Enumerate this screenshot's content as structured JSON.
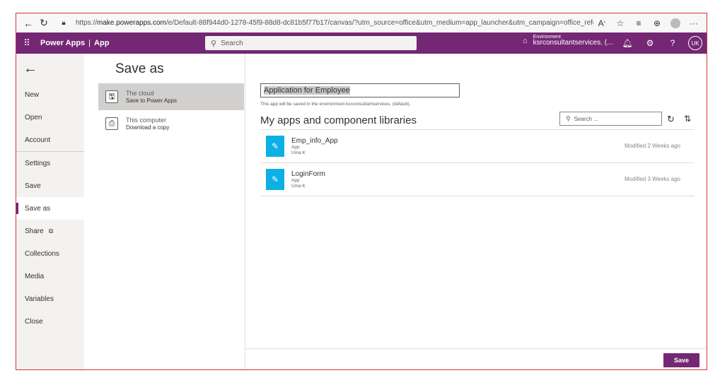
{
  "browser": {
    "url_prefix": "https://",
    "url_host": "make.powerapps.com",
    "url_rest": "/e/Default-88f944d0-1278-45f9-88d8-dc81b5f77b17/canvas/?utm_source=office&utm_medium=app_launcher&utm_campaign=office_referrals&actio…",
    "icons": [
      "back-icon",
      "refresh-icon",
      "lock-icon",
      "read-aloud-icon",
      "favorite-icon",
      "favorites-list-icon",
      "collections-icon",
      "profile-icon",
      "more-icon"
    ]
  },
  "header": {
    "app_name": "Power Apps",
    "separator": "|",
    "context": "App",
    "search_placeholder": "Search",
    "environment_label": "Environment",
    "environment_name": "ksrconsultantservices. (...",
    "avatar_initials": "UK",
    "brand_color": "#742774"
  },
  "nav": {
    "items": [
      {
        "label": "New"
      },
      {
        "label": "Open"
      },
      {
        "label": "Account"
      },
      {
        "label": "Settings"
      },
      {
        "label": "Save"
      },
      {
        "label": "Save as",
        "active": true
      },
      {
        "label": "Share"
      },
      {
        "label": "Collections"
      },
      {
        "label": "Media"
      },
      {
        "label": "Variables"
      },
      {
        "label": "Close"
      }
    ]
  },
  "saveas": {
    "title": "Save as",
    "options": [
      {
        "main": "The cloud",
        "sub": "Save to Power Apps",
        "selected": true
      },
      {
        "main": "This computer",
        "sub": "Download a copy",
        "selected": false
      }
    ]
  },
  "main": {
    "app_name_value": "Application for Employee",
    "save_note": "This app will be saved in the environment ksrconsultantservices. (default).",
    "section_title": "My apps and component libraries",
    "list_search_placeholder": "Search ...",
    "apps": [
      {
        "name": "Emp_info_App",
        "type": "App",
        "owner": "Uma K",
        "modified": "Modified 2 Weeks ago"
      },
      {
        "name": "LoginForm",
        "type": "App",
        "owner": "Uma K",
        "modified": "Modified 3 Weeks ago"
      }
    ],
    "save_button": "Save",
    "tile_color": "#0cb0e5"
  }
}
